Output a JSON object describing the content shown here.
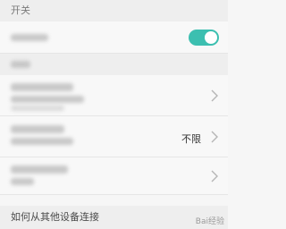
{
  "sections": {
    "switch_header": "开关",
    "devices_header": "",
    "other_devices_header": "如何从其他设备连接"
  },
  "rows": {
    "toggle_row": {
      "state": "on",
      "accent_color": "#3cbfb0"
    },
    "nav_rows": [
      {
        "value": ""
      },
      {
        "value": "不限"
      },
      {
        "value": ""
      }
    ]
  },
  "icons": {
    "chevron": "chevron-right-icon",
    "watermark": "baidu-jingyan-watermark"
  },
  "watermark": {
    "text": "Bai经验"
  }
}
